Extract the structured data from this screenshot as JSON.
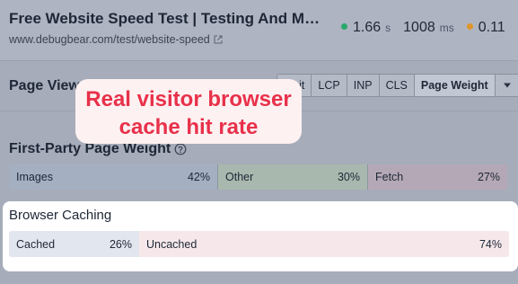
{
  "header": {
    "title": "Free Website Speed Test | Testing And Monitoring",
    "url": "www.debugbear.com/test/website-speed",
    "metrics": [
      {
        "value": "1.66",
        "unit": "s",
        "color": "#2aa86b"
      },
      {
        "value": "1008",
        "unit": "ms",
        "color": null
      },
      {
        "value": "0.11",
        "unit": "",
        "color": "#e0952a"
      }
    ]
  },
  "page_view": {
    "title": "Page View",
    "tabs": [
      "Visit",
      "LCP",
      "INP",
      "CLS",
      "Page Weight"
    ],
    "active_tab": "Page Weight"
  },
  "first_party": {
    "title": "First-Party Page Weight",
    "segments": [
      {
        "label": "Images",
        "percent": "42%",
        "share": 0.42,
        "color": "#a4b0c2"
      },
      {
        "label": "Other",
        "percent": "30%",
        "share": 0.3,
        "color": "#a9b8ae"
      },
      {
        "label": "Fetch",
        "percent": "27%",
        "share": 0.28,
        "color": "#b5a8b6"
      }
    ]
  },
  "browser_caching": {
    "title": "Browser Caching",
    "segments": [
      {
        "label": "Cached",
        "percent": "26%",
        "share": 0.26,
        "color": "#e2e6ee"
      },
      {
        "label": "Uncached",
        "percent": "74%",
        "share": 0.74,
        "color": "#f6e8ea"
      }
    ]
  },
  "callout": {
    "line1": "Real visitor browser",
    "line2": "cache hit rate",
    "color": "#e8314a"
  }
}
